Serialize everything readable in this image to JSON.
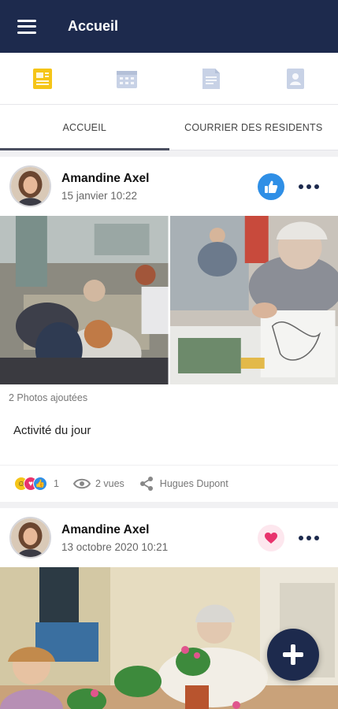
{
  "appbar": {
    "title": "Accueil",
    "menu_icon": "hamburger-menu-icon"
  },
  "iconbar": {
    "items": [
      {
        "icon": "news-feed-icon",
        "color": "#f5c518",
        "active": true
      },
      {
        "icon": "calendar-icon",
        "color": "#c8d2e6",
        "active": false
      },
      {
        "icon": "documents-icon",
        "color": "#c8d2e6",
        "active": false
      },
      {
        "icon": "contacts-icon",
        "color": "#c8d2e6",
        "active": false
      }
    ]
  },
  "tabs": [
    {
      "label": "ACCUEIL",
      "active": true
    },
    {
      "label": "COURRIER DES RESIDENTS",
      "active": false
    }
  ],
  "posts": [
    {
      "author": "Amandine Axel",
      "date": "15 janvier 10:22",
      "reaction": "thumbs-up-icon",
      "reaction_color": "#2f8fe6",
      "photos_count": "2 Photos ajoutées",
      "text": "Activité du jour",
      "reactions_count": "1",
      "views": "2 vues",
      "shared_with": "Hugues Dupont"
    },
    {
      "author": "Amandine Axel",
      "date": "13 octobre 2020 10:21",
      "reaction": "heart-icon",
      "reaction_color": "#e8336d"
    }
  ],
  "colors": {
    "primary": "#1d2a4d",
    "accent_yellow": "#f5c518",
    "like_blue": "#2f8fe6",
    "heart_pink": "#e8336d"
  },
  "fab": {
    "icon": "plus-icon"
  }
}
